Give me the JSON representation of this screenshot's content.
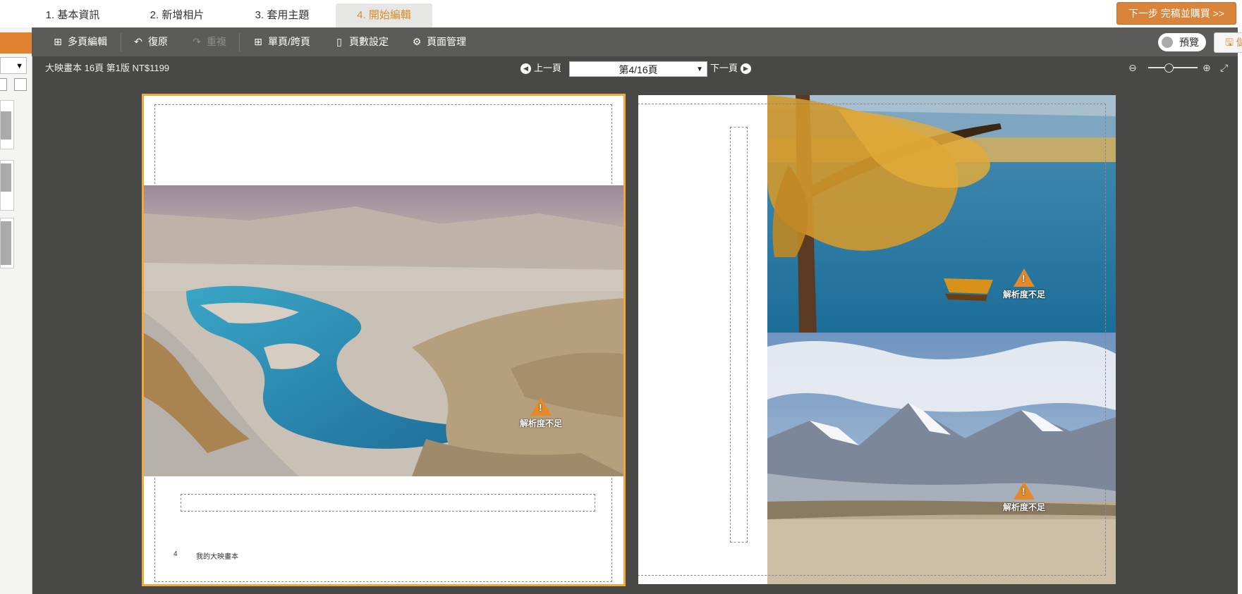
{
  "steps": [
    {
      "label": "1. 基本資訊",
      "active": false
    },
    {
      "label": "2. 新增相片",
      "active": false
    },
    {
      "label": "3. 套用主題",
      "active": false
    },
    {
      "label": "4. 開始編輯",
      "active": true
    }
  ],
  "next_button": "下一步 完稿並購買 >>",
  "toolbar": {
    "multi_edit": "多頁編輯",
    "undo": "復原",
    "redo": "重複",
    "single_spread": "單頁/跨頁",
    "page_count": "頁數設定",
    "page_manage": "頁面管理",
    "preview": "預覽",
    "save": "儲存"
  },
  "book_info": "大映畫本 16頁 第1版 NT$1199",
  "pager": {
    "prev": "上一頁",
    "current": "第4/16頁",
    "next": "下一頁"
  },
  "zoom_level": 0.33,
  "left_page": {
    "page_number": "4",
    "footer_title": "我的大映畫本",
    "warning": "解析度不足"
  },
  "right_page": {
    "warning_top": "解析度不足",
    "warning_bottom": "解析度不足"
  },
  "colors": {
    "accent": "#d98a2b",
    "workspace": "#484846",
    "toolbar": "#5b5b59",
    "selected_page_border": "#f2a83a"
  }
}
